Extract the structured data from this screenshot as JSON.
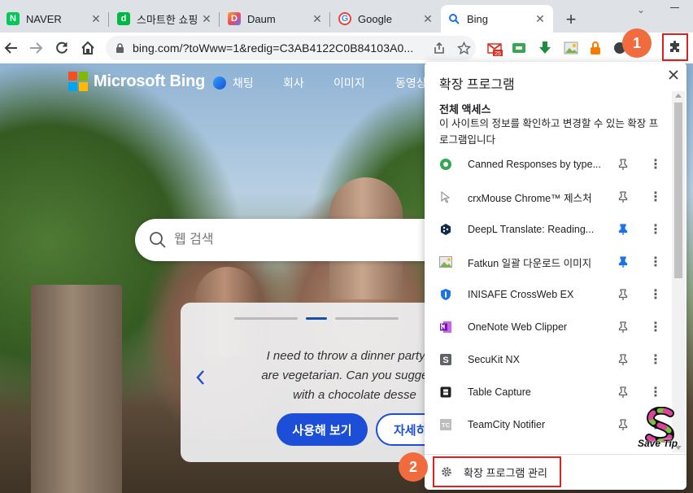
{
  "tabs": [
    {
      "title": "NAVER",
      "favicon": "naver-icon",
      "color": "#03c75a",
      "glyph": "N"
    },
    {
      "title": "스마트한 쇼핑",
      "favicon": "smartstore-icon",
      "color": "#00b843",
      "glyph": "d"
    },
    {
      "title": "Daum",
      "favicon": "daum-icon",
      "color": "#5b7cf6",
      "glyph": "D"
    },
    {
      "title": "Google",
      "favicon": "google-icon",
      "color": "#4285f4",
      "glyph": "G"
    },
    {
      "title": "Bing",
      "favicon": "bing-search-icon",
      "color": "#1a73e8",
      "glyph": "Q"
    }
  ],
  "toolbar": {
    "url": "bing.com/?toWww=1&redig=C3AB4122C0B84103A0..."
  },
  "bing": {
    "logo_text": "Microsoft Bing",
    "nav": [
      "채팅",
      "회사",
      "이미지",
      "동영상"
    ],
    "search_placeholder": "웹 검색",
    "card_lines": [
      "I need to throw a dinner party for",
      "are vegetarian. Can you suggest a",
      "with a chocolate desse"
    ],
    "primary_button": "사용해 보기",
    "secondary_button": "자세히"
  },
  "popup": {
    "title": "확장 프로그램",
    "section_title": "전체 액세스",
    "section_desc": "이 사이트의 정보를 확인하고 변경할 수 있는 확장 프로그램입니다",
    "extensions": [
      {
        "name": "Canned Responses by type...",
        "icon": "canned-responses-icon",
        "pinned": false
      },
      {
        "name": "crxMouse Chrome™ 제스처",
        "icon": "crxmouse-icon",
        "pinned": false
      },
      {
        "name": "DeepL Translate: Reading...",
        "icon": "deepl-icon",
        "pinned": true
      },
      {
        "name": "Fatkun 일괄 다운로드 이미지",
        "icon": "fatkun-icon",
        "pinned": true
      },
      {
        "name": "INISAFE CrossWeb EX",
        "icon": "inisafe-shield-icon",
        "pinned": false
      },
      {
        "name": "OneNote Web Clipper",
        "icon": "onenote-icon",
        "pinned": false
      },
      {
        "name": "SecuKit NX",
        "icon": "secukit-icon",
        "pinned": false
      },
      {
        "name": "Table Capture",
        "icon": "table-capture-icon",
        "pinned": false
      },
      {
        "name": "TeamCity Notifier",
        "icon": "teamcity-icon",
        "pinned": false
      }
    ],
    "manage_label": "확장 프로그램 관리"
  },
  "annotations": {
    "badge1": "1",
    "badge2": "2"
  },
  "watermark": {
    "text": "Save Tip"
  },
  "colors": {
    "accent": "#1a73e8",
    "pin_active": "#1a73e8",
    "badge": "#f06b3d",
    "highlight_box": "#e02020",
    "bing_button": "#1d4ed8"
  }
}
